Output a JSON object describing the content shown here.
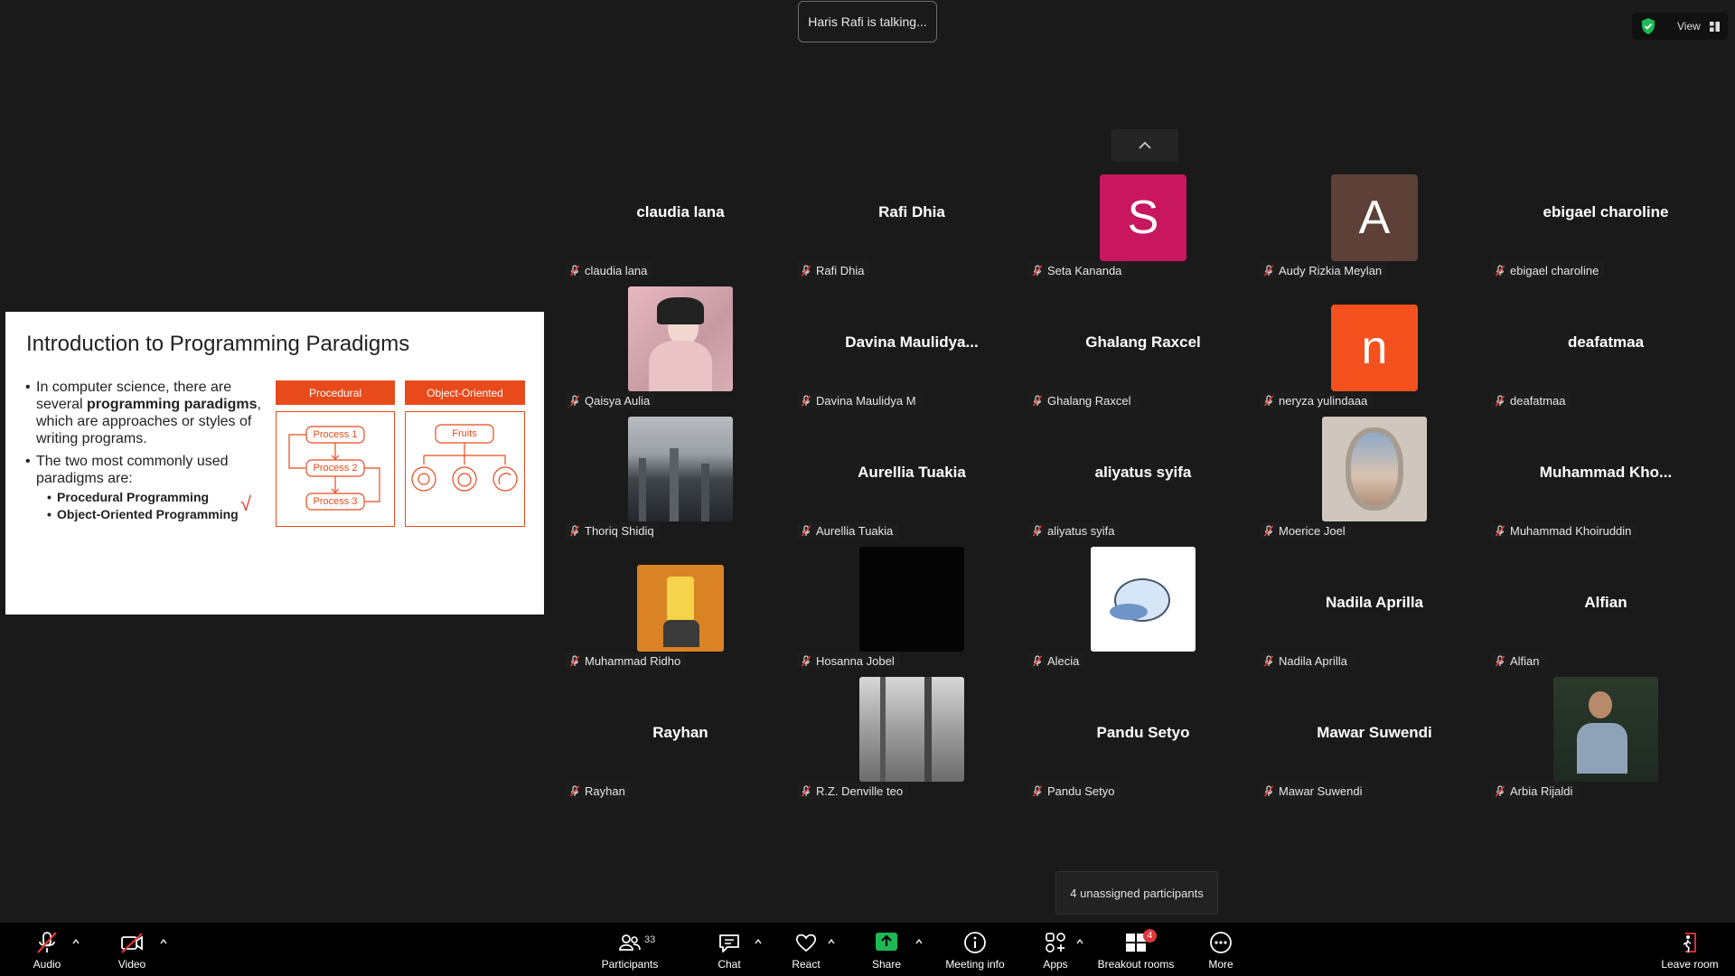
{
  "top": {
    "talking_indicator": "Haris Rafi is talking...",
    "view_label": "View"
  },
  "slide": {
    "title": "Introduction to Programming Paradigms",
    "bullet1_pre": "In computer science, there are several ",
    "bullet1_bold": "programming paradigms",
    "bullet1_post": ", which are approaches or styles of writing programs.",
    "bullet2": "The two most commonly used paradigms are:",
    "sub1": "Procedural Programming",
    "sub2": "Object-Oriented Programming",
    "check_mark": "√",
    "col1_title": "Procedural",
    "col2_title": "Object-Oriented",
    "process1": "Process 1",
    "process2": "Process 2",
    "process3": "Process 3",
    "fruits": "Fruits"
  },
  "participants": [
    {
      "label": "claudia lana",
      "center": "claudia lana"
    },
    {
      "label": "Rafi Dhia",
      "center": "Rafi Dhia"
    },
    {
      "label": "Seta Kananda",
      "letter": "S",
      "color": "#c8175e"
    },
    {
      "label": "Audy Rizkia Meylan",
      "letter": "A",
      "color": "#5d4037"
    },
    {
      "label": "ebigael charoline",
      "center": "ebigael charoline"
    },
    {
      "label": "Qaisya Aulia",
      "photo": "pink"
    },
    {
      "label": "Davina Maulidya M",
      "center": "Davina  Maulidya..."
    },
    {
      "label": "Ghalang Raxcel",
      "center": "Ghalang Raxcel"
    },
    {
      "label": "neryza yulindaaa",
      "letter": "n",
      "color": "#f4511e"
    },
    {
      "label": "deafatmaa",
      "center": "deafatmaa"
    },
    {
      "label": "Thoriq Shidiq",
      "photo": "city"
    },
    {
      "label": "Aurellia Tuakia",
      "center": "Aurellia Tuakia"
    },
    {
      "label": "aliyatus syifa",
      "center": "aliyatus syifa"
    },
    {
      "label": "Moerice Joel",
      "photo": "window"
    },
    {
      "label": "Muhammad Khoiruddin",
      "center": "Muhammad  Kho..."
    },
    {
      "label": "Muhammad Ridho",
      "photo": "cartoon"
    },
    {
      "label": "Hosanna Jobel",
      "photo": "black"
    },
    {
      "label": "Alecia",
      "photo": "cat"
    },
    {
      "label": "Nadila Aprilla",
      "center": "Nadila Aprilla"
    },
    {
      "label": "Alfian",
      "center": "Alfian"
    },
    {
      "label": "Rayhan",
      "center": "Rayhan"
    },
    {
      "label": "R.Z. Denville teo",
      "photo": "forest"
    },
    {
      "label": "Pandu Setyo",
      "center": "Pandu Setyo"
    },
    {
      "label": "Mawar Suwendi",
      "center": "Mawar Suwendi"
    },
    {
      "label": "Arbia Rijaldi",
      "photo": "person"
    }
  ],
  "unassigned": "4 unassigned participants",
  "toolbar": {
    "audio": "Audio",
    "video": "Video",
    "participants": "Participants",
    "participants_count": "33",
    "chat": "Chat",
    "react": "React",
    "share": "Share",
    "meeting_info": "Meeting info",
    "apps": "Apps",
    "breakout_rooms": "Breakout rooms",
    "breakout_badge": "4",
    "more": "More",
    "leave_room": "Leave room"
  }
}
